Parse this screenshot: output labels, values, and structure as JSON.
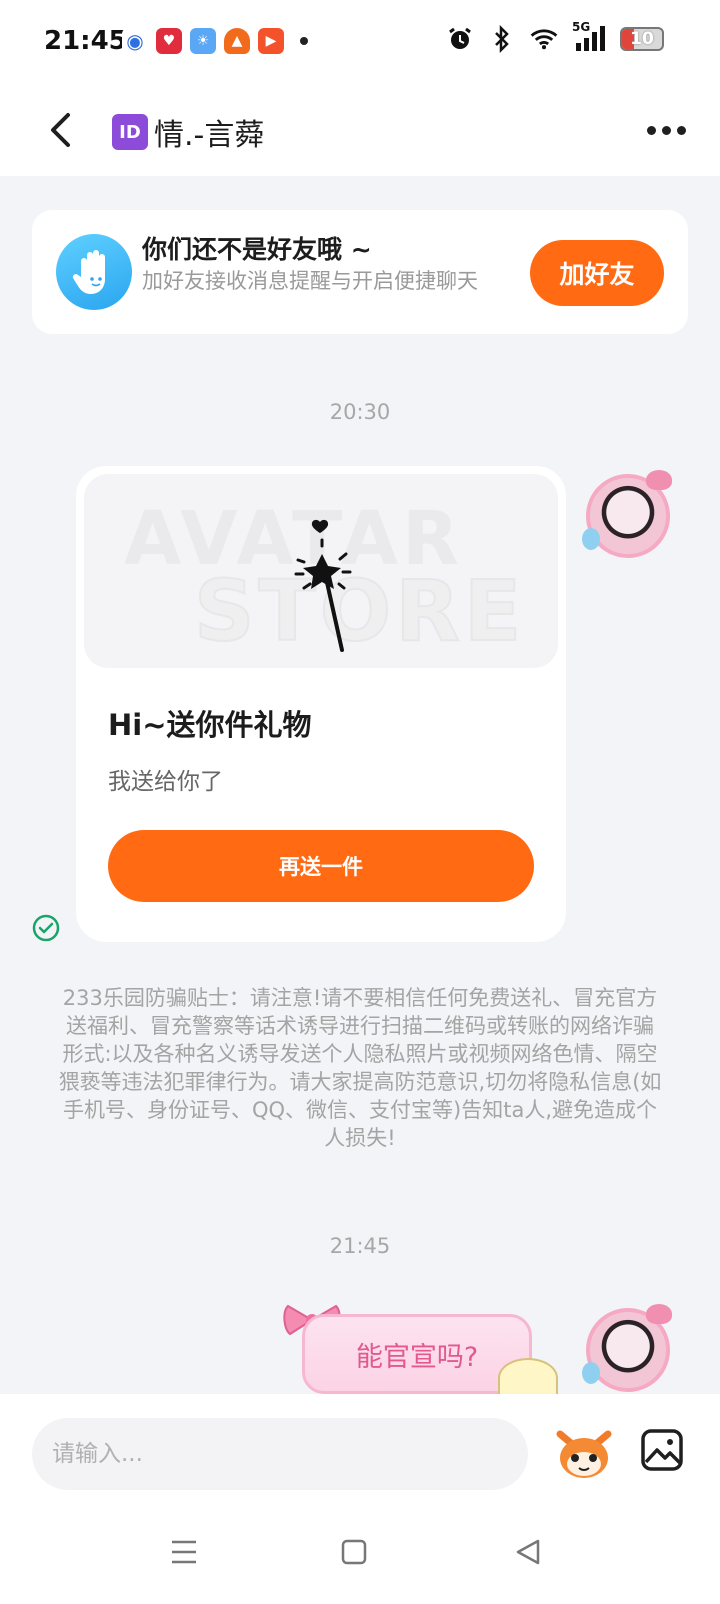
{
  "status_bar": {
    "time": "21:45",
    "signal": "5G",
    "battery": "10"
  },
  "header": {
    "id_badge": "ID",
    "title": "情.-言蕣"
  },
  "friend_prompt": {
    "title": "你们还不是好友哦 ~",
    "subtitle": "加好友接收消息提醒与开启便捷聊天",
    "add_button": "加好友"
  },
  "messages": {
    "time_1": "20:30",
    "gift": {
      "watermark_1": "AVATAR",
      "watermark_2": "STORE",
      "title": "Hi~送你件礼物",
      "description": "我送给你了",
      "send_again_button": "再送一件"
    },
    "warning": "233乐园防骗贴士：请注意!请不要相信任何免费送礼、冒充官方送福利、冒充警察等话术诱导进行扫描二维码或转账的网络诈骗形式:以及各种名义诱导发送个人隐私照片或视频网络色情、隔空猥亵等违法犯罪律行为。请大家提高防范意识,切勿将隐私信息(如手机号、身份证号、QQ、微信、支付宝等)告知ta人,避免造成个人损失!",
    "time_2": "21:45",
    "bubble_text": "能官宣吗?"
  },
  "input": {
    "placeholder": "请输入..."
  },
  "colors": {
    "accent": "#ff6a13",
    "background": "#f3f4f7",
    "bubble_text": "#e2588f",
    "check": "#1aa46a"
  }
}
